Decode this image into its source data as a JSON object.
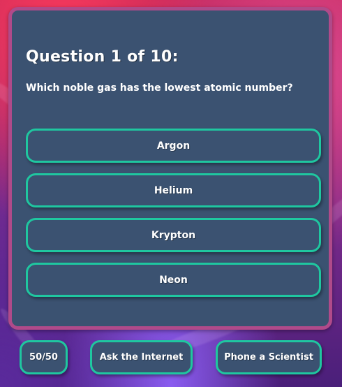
{
  "question": {
    "title": "Question 1 of 10:",
    "text": "Which noble gas has the lowest atomic number?"
  },
  "answers": [
    {
      "label": "Argon"
    },
    {
      "label": "Helium"
    },
    {
      "label": "Krypton"
    },
    {
      "label": "Neon"
    }
  ],
  "lifelines": {
    "fifty_fifty": "50/50",
    "ask_internet": "Ask the Internet",
    "phone_scientist": "Phone a Scientist"
  },
  "colors": {
    "card_background": "#3b5271",
    "card_border": "#b04a8a",
    "button_border": "#1fc7a0",
    "text": "#ffffff"
  }
}
